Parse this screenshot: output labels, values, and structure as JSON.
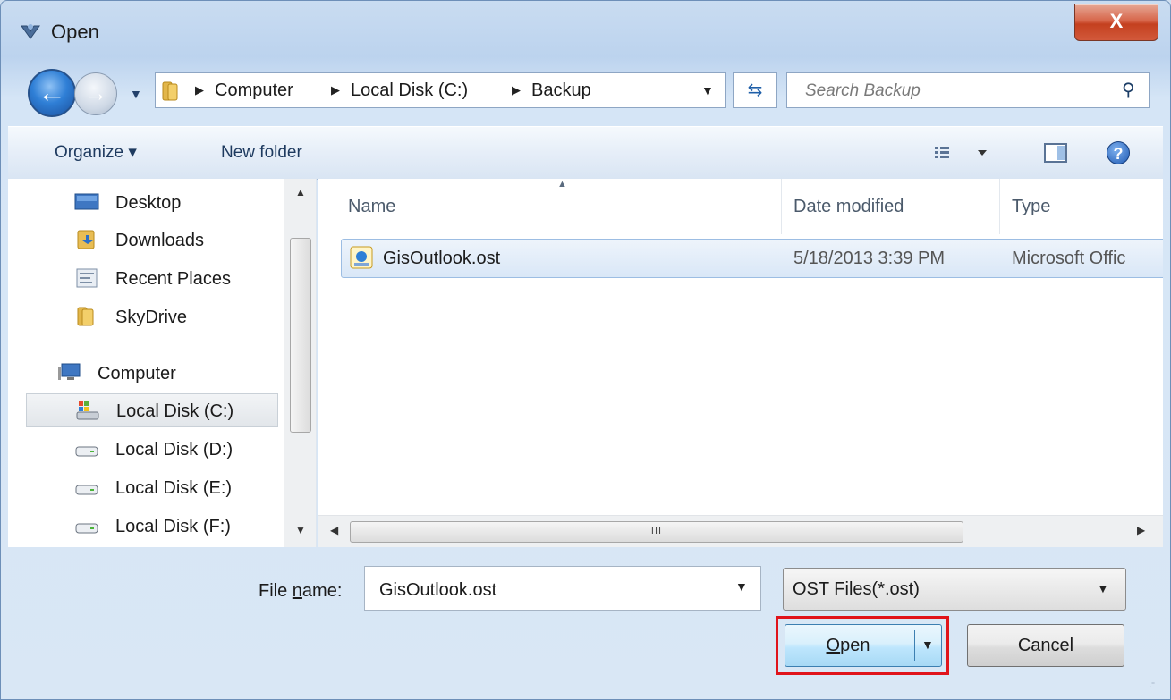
{
  "window": {
    "title": "Open",
    "close_label": "X"
  },
  "nav": {
    "back_icon": "back-arrow-icon",
    "forward_icon": "forward-arrow-icon",
    "breadcrumb": [
      "Computer",
      "Local Disk (C:)",
      "Backup"
    ],
    "search_placeholder": "Search Backup"
  },
  "toolbar": {
    "organize": "Organize ▾",
    "new_folder": "New folder"
  },
  "sidebar": {
    "items": [
      {
        "label": "Desktop",
        "icon": "desktop-icon"
      },
      {
        "label": "Downloads",
        "icon": "downloads-folder-icon"
      },
      {
        "label": "Recent Places",
        "icon": "recent-places-icon"
      },
      {
        "label": "SkyDrive",
        "icon": "folder-icon"
      },
      {
        "label": "Computer",
        "icon": "computer-icon"
      },
      {
        "label": "Local Disk (C:)",
        "icon": "system-drive-icon",
        "selected": true
      },
      {
        "label": "Local Disk (D:)",
        "icon": "drive-icon"
      },
      {
        "label": "Local Disk (E:)",
        "icon": "drive-icon"
      },
      {
        "label": "Local Disk (F:)",
        "icon": "drive-icon"
      }
    ]
  },
  "filelist": {
    "columns": [
      "Name",
      "Date modified",
      "Type"
    ],
    "rows": [
      {
        "name": "GisOutlook.ost",
        "date": "5/18/2013 3:39 PM",
        "type": "Microsoft Offic"
      }
    ],
    "scroll_grip": "III"
  },
  "footer": {
    "filename_label_pre": "File ",
    "filename_label_underline": "n",
    "filename_label_post": "ame:",
    "filename_value": "GisOutlook.ost",
    "filetype_value": "OST Files(*.ost)",
    "open_label_underline": "O",
    "open_label_rest": "pen",
    "cancel_label": "Cancel"
  },
  "colors": {
    "highlight": "#e0141b",
    "accent": "#3c7fb1"
  }
}
